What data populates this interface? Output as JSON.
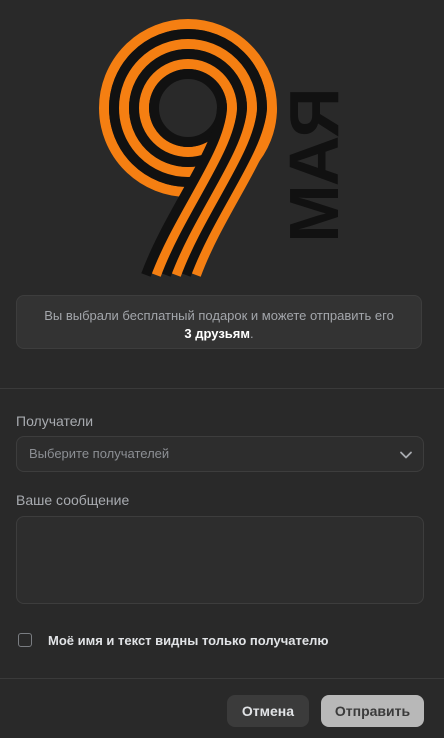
{
  "gift": {
    "number": "9",
    "word": "МАЯ"
  },
  "info": {
    "text": "Вы выбрали бесплатный подарок и можете отправить его",
    "count_text": "3 друзьям",
    "suffix": "."
  },
  "recipients": {
    "label": "Получатели",
    "placeholder": "Выберите получателей"
  },
  "message": {
    "label": "Ваше сообщение",
    "value": ""
  },
  "privacy": {
    "label": "Моё имя и текст видны только получателю",
    "checked": false
  },
  "actions": {
    "cancel_label": "Отмена",
    "send_label": "Отправить"
  },
  "colors": {
    "orange": "#f57f12",
    "black": "#111111",
    "background": "#292929"
  },
  "icons": {
    "select_chevron": "chevron-down-icon"
  }
}
